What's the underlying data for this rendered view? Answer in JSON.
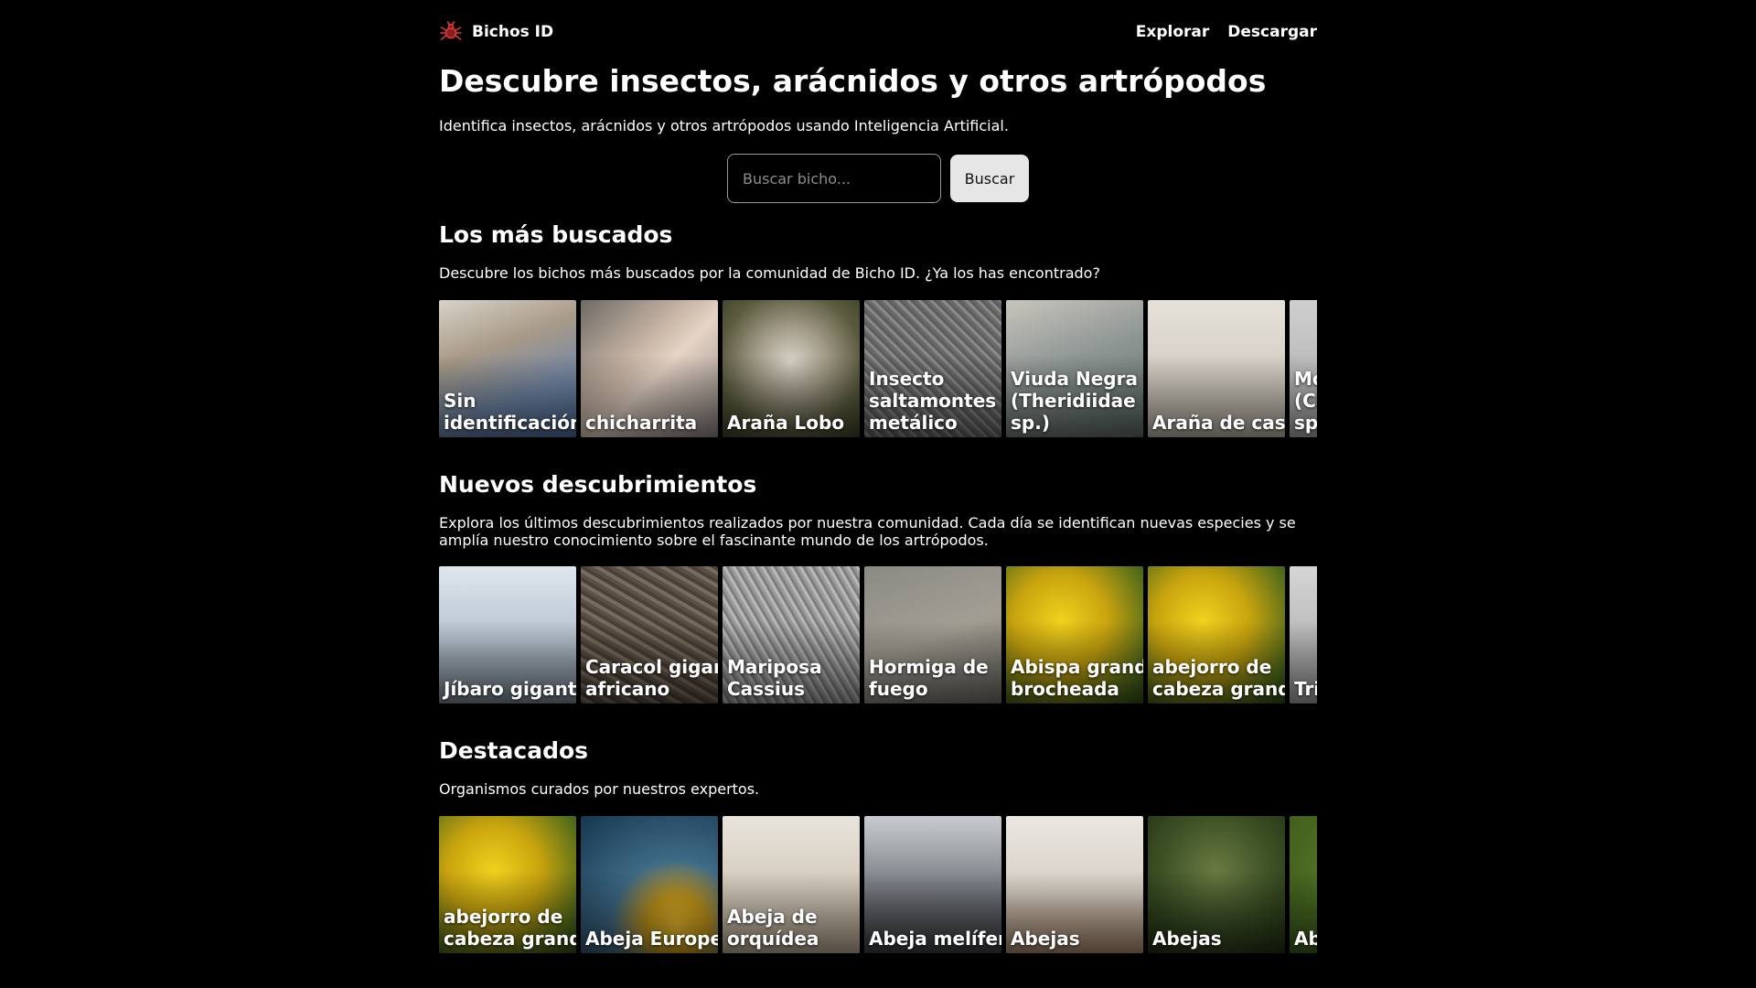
{
  "header": {
    "brand": "Bichos ID",
    "logo_icon": "bug-icon",
    "nav": [
      "Explorar",
      "Descargar"
    ]
  },
  "hero": {
    "title": "Descubre insectos, arácnidos y otros artrópodos",
    "subtitle": "Identifica insectos, arácnidos y otros artrópodos usando Inteligencia Artificial."
  },
  "search": {
    "placeholder": "Buscar bicho...",
    "value": "",
    "button": "Buscar"
  },
  "sections": [
    {
      "title": "Los más buscados",
      "description": "Descubre los bichos más buscados por la comunidad de Bicho ID. ¿Ya los has encontrado?",
      "cards": [
        {
          "label": "Sin identificación",
          "bg": "linear-gradient(160deg,#d8d2c8 0%,#a89a88 35%,#6f86a8 70%,#4a6a96 100%)"
        },
        {
          "label": "chicharrita",
          "bg": "linear-gradient(135deg,#6e6a66 0%,#c9b6a6 40%,#e6d4c6 55%,#8a8280 100%)"
        },
        {
          "label": "Araña Lobo",
          "bg": "radial-gradient(circle at 50% 45%,#d8d4c8 0%,#a09a86 35%,#5a5a3e 70%,#3c4026 100%)"
        },
        {
          "label": "Insecto saltamontes metálico",
          "bg": "repeating-linear-gradient(45deg,#6a6a6a 0 3px,#8a8a8a 3px 6px,#5e5e5e 6px 9px)"
        },
        {
          "label": "Viuda Negra (Theridiidae sp.)",
          "bg": "linear-gradient(160deg,#c8c4bc 0%,#8e9694 45%,#5a6a64 100%)"
        },
        {
          "label": "Araña de casa",
          "bg": "linear-gradient(180deg,#e6e2da 0%,#d2ccc2 60%,#bcb4a8 100%)"
        },
        {
          "label": "Mosca (Calliphoridae sp.)",
          "bg": "linear-gradient(180deg,#cfcfcf 0%,#a8a8a8 100%)"
        }
      ]
    },
    {
      "title": "Nuevos descubrimientos",
      "description": "Explora los últimos descubrimientos realizados por nuestra comunidad. Cada día se identifican nuevas especies y se amplía nuestro conocimiento sobre el fascinante mundo de los artrópodos.",
      "cards": [
        {
          "label": "Jíbaro gigante",
          "bg": "linear-gradient(180deg,#dfe6ee 0%,#b6c2ce 55%,#7a8796 100%)"
        },
        {
          "label": "Caracol gigante africano",
          "bg": "repeating-linear-gradient(30deg,#5a5046 0 4px,#7a6c5c 4px 8px,#4a4036 8px 12px)"
        },
        {
          "label": "Mariposa Cassius",
          "bg": "repeating-linear-gradient(60deg,#9a9a9a 0 3px,#b8b8b8 3px 6px,#7e7e7e 6px 9px)"
        },
        {
          "label": "Hormiga de fuego",
          "bg": "linear-gradient(160deg,#8a8a84 0%,#a29e94 50%,#6e6c64 100%)"
        },
        {
          "label": "Abispa grande brocheada",
          "bg": "radial-gradient(circle at 40% 40%,#f0d21e 0%,#c9a40e 40%,#4e6a1a 80%,#2e4a12 100%)"
        },
        {
          "label": "abejorro de cabeza grande",
          "bg": "radial-gradient(circle at 40% 40%,#f0d21e 0%,#c9a40e 40%,#4e6a1a 80%,#2e4a12 100%)"
        },
        {
          "label": "Trips (agua)",
          "bg": "linear-gradient(180deg,#d6d6d6 0%,#a0a0a0 100%)"
        }
      ]
    },
    {
      "title": "Destacados",
      "description": "Organismos curados por nuestros expertos.",
      "cards": [
        {
          "label": "abejorro de cabeza grande",
          "bg": "radial-gradient(circle at 40% 40%,#f0d21e 0%,#c9a40e 40%,#4e6a1a 80%,#2e4a12 100%)"
        },
        {
          "label": "Abeja Europea",
          "bg": "radial-gradient(circle at 70% 80%,#f2c230 0%,#c89a1a 20%,#3e6a86 45%,#16364e 100%)"
        },
        {
          "label": "Abeja de orquídea",
          "bg": "linear-gradient(180deg,#e8e4dc 0%,#d2c8b8 60%,#b8a890 100%)"
        },
        {
          "label": "Abeja melífera",
          "bg": "linear-gradient(180deg,#c8ccd0 0%,#7e8288 50%,#3a3c40 100%)"
        },
        {
          "label": "Abejas",
          "bg": "linear-gradient(180deg,#eae6e2 0%,#d8d0c6 55%,#a8886a 100%)"
        },
        {
          "label": "Abejas",
          "bg": "radial-gradient(circle at 50% 40%,#6a7a42 0%,#3e5226 50%,#1e2e12 100%)"
        },
        {
          "label": "Abejas",
          "bg": "radial-gradient(circle at 50% 40%,#5a7a2a 0%,#3a5a1a 100%)"
        }
      ]
    }
  ]
}
